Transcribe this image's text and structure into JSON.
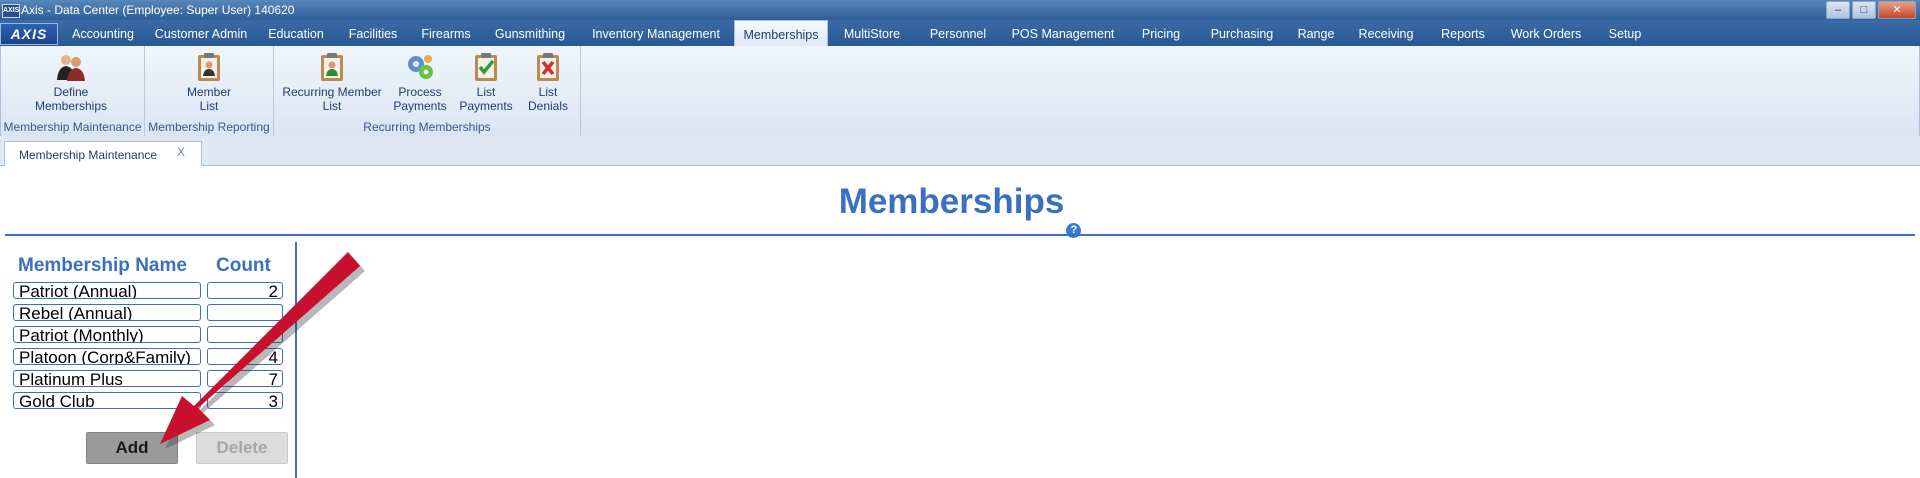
{
  "window": {
    "title": "Axis - Data Center  (Employee: Super User) 140620",
    "logo": "AXIS",
    "controls": [
      "minimize-icon",
      "maximize-icon",
      "close-icon"
    ]
  },
  "menu": {
    "tabs": [
      "Accounting",
      "Customer Admin",
      "Education",
      "Facilities",
      "Firearms",
      "Gunsmithing",
      "Inventory Management",
      "Memberships",
      "MultiStore",
      "Personnel",
      "POS Management",
      "Pricing",
      "Purchasing",
      "Range",
      "Receiving",
      "Reports",
      "Work Orders",
      "Setup"
    ],
    "active": "Memberships"
  },
  "ribbon": {
    "groups": [
      {
        "label": "Membership Maintenance",
        "buttons": [
          {
            "line1": "Define",
            "line2": "Memberships",
            "icon": "people-icon"
          }
        ]
      },
      {
        "label": "Membership Reporting",
        "buttons": [
          {
            "line1": "Member",
            "line2": "List",
            "icon": "clipboard-person-icon"
          }
        ]
      },
      {
        "label": "Recurring Memberships",
        "buttons": [
          {
            "line1": "Recurring Member",
            "line2": "List",
            "icon": "clipboard-person-green-icon"
          },
          {
            "line1": "Process",
            "line2": "Payments",
            "icon": "gears-icon"
          },
          {
            "line1": "List",
            "line2": "Payments",
            "icon": "clipboard-check-icon"
          },
          {
            "line1": "List",
            "line2": "Denials",
            "icon": "clipboard-denied-icon"
          }
        ]
      }
    ]
  },
  "doc_tab": {
    "label": "Membership Maintenance",
    "close": "X"
  },
  "page": {
    "title": "Memberships",
    "help": "?",
    "columns": {
      "name": "Membership Name",
      "count": "Count"
    },
    "rows": [
      {
        "name": "Patriot (Annual)",
        "count": "2"
      },
      {
        "name": "Rebel (Annual)",
        "count": ""
      },
      {
        "name": "Patriot (Monthly)",
        "count": ""
      },
      {
        "name": "Platoon (Corp&Family)",
        "count": "4"
      },
      {
        "name": "Platinum Plus",
        "count": "7"
      },
      {
        "name": "Gold Club",
        "count": "3"
      }
    ],
    "buttons": {
      "add": "Add",
      "delete": "Delete"
    }
  },
  "colors": {
    "accent": "#3a6fc2",
    "menubar": "#285992",
    "arrow": "#c8102e"
  }
}
